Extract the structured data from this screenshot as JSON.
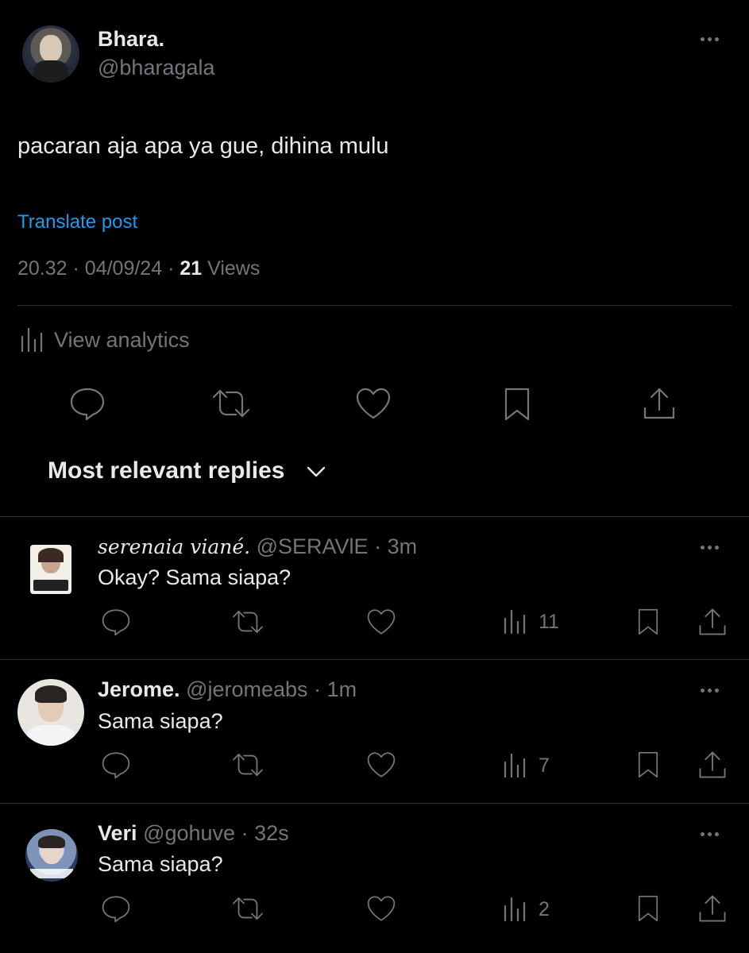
{
  "post": {
    "display_name": "Bhara.",
    "handle": "@bharagala",
    "text": "pacaran aja apa ya gue, dihina mulu",
    "translate_label": "Translate post",
    "time": "20.32",
    "date": "04/09/24",
    "views_count": "21",
    "views_label": "Views",
    "analytics_label": "View analytics"
  },
  "replies_sort": {
    "label": "Most relevant replies"
  },
  "replies": [
    {
      "name": "serenaia viané.",
      "handle": "@SERAVlE",
      "time": "3m",
      "text": "Okay? Sama siapa?",
      "views": "11"
    },
    {
      "name": "Jerome.",
      "handle": "@jeromeabs",
      "time": "1m",
      "text": "Sama siapa?",
      "views": "7"
    },
    {
      "name": "Veri",
      "handle": "@gohuve",
      "time": "32s",
      "text": "Sama siapa?",
      "views": "2"
    }
  ],
  "sep": "·",
  "colors": {
    "background": "#000000",
    "text": "#e7e9ea",
    "secondary": "#71767b",
    "link": "#1d9bf0",
    "divider": "#2f3336"
  }
}
